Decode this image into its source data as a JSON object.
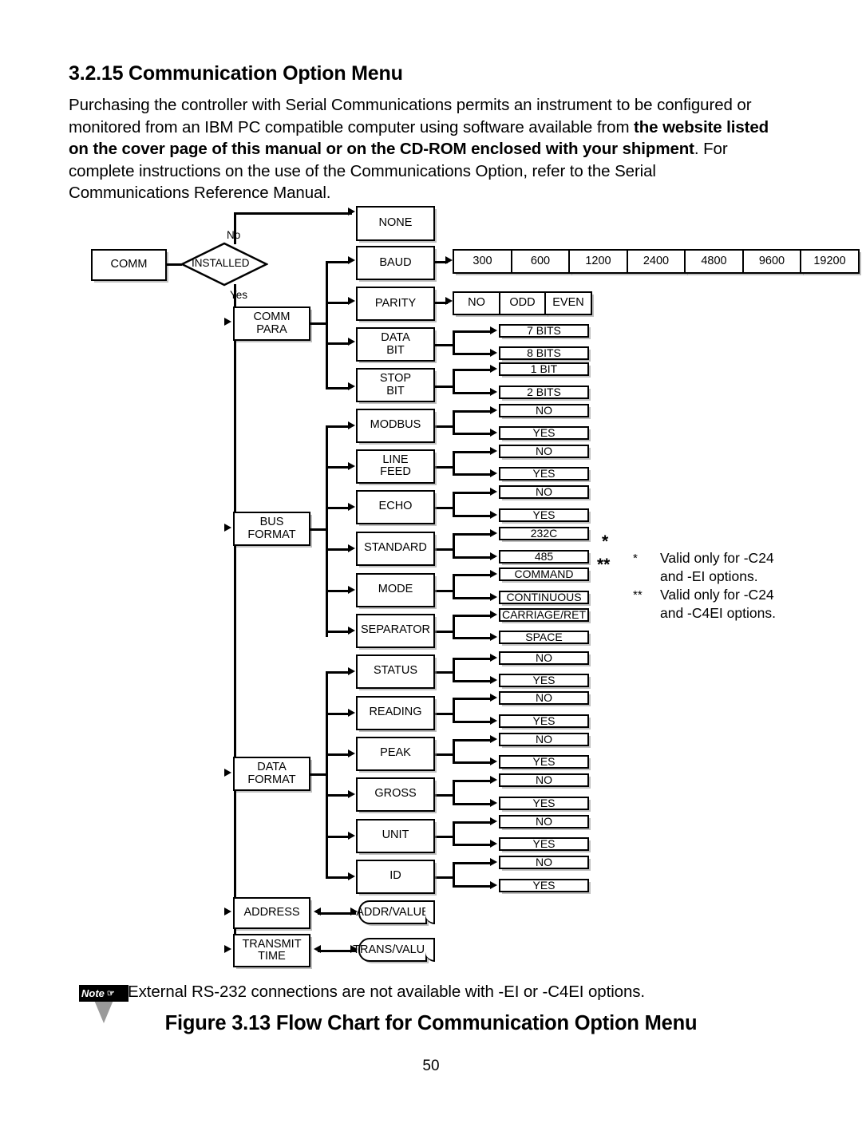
{
  "heading": "3.2.15 Communication Option Menu",
  "intro": {
    "part1": "Purchasing the controller with Serial Communications permits an instrument to be configured or monitored from an IBM PC compatible computer using software available from ",
    "bold": "the website listed on the cover page of this manual or on the CD-ROM enclosed with your shipment",
    "part2": ". For complete instructions on the use of the Communications Option, refer to the Serial Communications Reference Manual."
  },
  "flowchart": {
    "start": "COMM",
    "decision": "INSTALLED",
    "branch_no": "No",
    "branch_yes": "Yes",
    "none": "NONE",
    "groups": {
      "comm_para": "COMM PARA",
      "bus_format": "BUS FORMAT",
      "data_format": "DATA FORMAT",
      "address": "ADDRESS",
      "transmit_time": "TRANSMIT TIME"
    },
    "params": {
      "baud": "BAUD",
      "parity": "PARITY",
      "data_bit": "DATA BIT",
      "stop_bit": "STOP BIT",
      "modbus": "MODBUS",
      "line_feed": "LINE FEED",
      "echo": "ECHO",
      "standard": "STANDARD",
      "mode": "MODE",
      "separator": "SEPARATOR",
      "status": "STATUS",
      "reading": "READING",
      "peak": "PEAK",
      "gross": "GROSS",
      "unit": "UNIT",
      "id": "ID"
    },
    "baud_values": [
      "300",
      "600",
      "1200",
      "2400",
      "4800",
      "9600",
      "19200"
    ],
    "parity_values": [
      "NO",
      "ODD",
      "EVEN"
    ],
    "data_bit_values": [
      "7 BITS",
      "8 BITS"
    ],
    "stop_bit_values": [
      "1 BIT",
      "2 BITS"
    ],
    "modbus_values": [
      "NO",
      "YES"
    ],
    "line_feed_values": [
      "NO",
      "YES"
    ],
    "echo_values": [
      "NO",
      "YES"
    ],
    "standard_values": [
      "232C",
      "485"
    ],
    "mode_values": [
      "COMMAND",
      "CONTINUOUS"
    ],
    "separator_values": [
      "CARRIAGE/RET",
      "SPACE"
    ],
    "status_values": [
      "NO",
      "YES"
    ],
    "reading_values": [
      "NO",
      "YES"
    ],
    "peak_values": [
      "NO",
      "YES"
    ],
    "gross_values": [
      "NO",
      "YES"
    ],
    "unit_values": [
      "NO",
      "YES"
    ],
    "id_values": [
      "NO",
      "YES"
    ],
    "address_value": "ADDR/VALUE",
    "transmit_value": "TRANS/VALUE",
    "marker_single": "*",
    "marker_double": "**"
  },
  "legend": [
    {
      "mark": "*",
      "text": "Valid only for -C24 and -EI options."
    },
    {
      "mark": "**",
      "text": "Valid only for -C24 and -C4EI options."
    }
  ],
  "note": {
    "badge": "Note",
    "hand_icon": "☞",
    "text": "External RS-232 connections are not available with -EI or -C4EI options."
  },
  "figure_caption": "Figure 3.13 Flow Chart for Communication Option Menu",
  "page_number": "50"
}
